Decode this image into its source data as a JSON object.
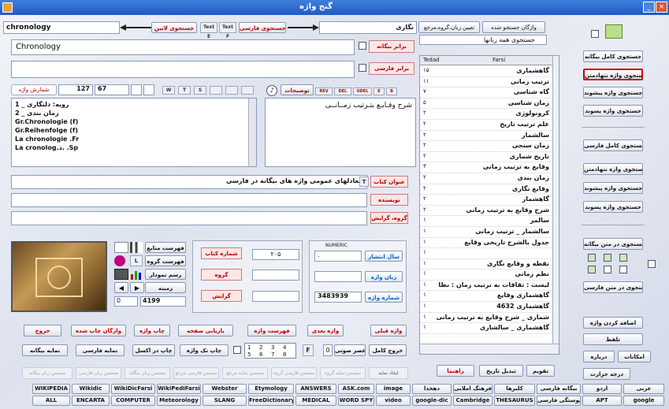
{
  "window": {
    "title": "گنج واژه",
    "min": "_",
    "close": "×"
  },
  "search": {
    "latin_value": "chronology",
    "latin_button": "جستجوی لاتین",
    "text_e": "Text E",
    "text_f": "Text F",
    "persian_button": "جستجوی فارسی",
    "persian_value": "نگاری",
    "mode_buttons": [
      "واژگان جستجو شده",
      "تعیین زبان،گروه،مرجع"
    ],
    "lang_select": "جستجوی همه زبانها",
    "equiv_value": "Chronology",
    "equiv_label": "برابر بیگانه",
    "persian_label": "برابر فارسی"
  },
  "wordlist": {
    "header": [
      "Tedad",
      "Farsi"
    ],
    "rows": [
      {
        "n": "۱۵",
        "w": "گاهشماری"
      },
      {
        "n": "۱۱",
        "w": "ترتیب زمانی"
      },
      {
        "n": "۷",
        "w": "گاه شناسی"
      },
      {
        "n": "۵",
        "w": "زمان شناسی"
      },
      {
        "n": "۲",
        "w": "کرونولوژی"
      },
      {
        "n": "۲",
        "w": "علم ترتیب تاریخ"
      },
      {
        "n": "۲",
        "w": "سالشمار"
      },
      {
        "n": "۲",
        "w": "زمان سنجی"
      },
      {
        "n": "۲",
        "w": "تاریخ شماری"
      },
      {
        "n": "۳",
        "w": "وقایع به ترتیب زمانی"
      },
      {
        "n": "۲",
        "w": "زمان بندی"
      },
      {
        "n": "۲",
        "w": "وقایع نگاری"
      },
      {
        "n": "۲",
        "w": "گاهشمار"
      },
      {
        "n": "۲",
        "w": "شرح وقایع به ترتیب زمانی"
      },
      {
        "n": "۱",
        "w": "سالمر"
      },
      {
        "n": "۱",
        "w": "سالشمار _ ترتیب زمانی"
      },
      {
        "n": "۱",
        "w": "جدول بالشرح تاریخی وقایع"
      },
      {
        "n": "۱",
        "w": ""
      },
      {
        "n": "۱",
        "w": "نقطه و وقایع نگاری"
      },
      {
        "n": "۱",
        "w": "نظم زمانی"
      },
      {
        "n": "۱",
        "w": "لیست : تقاقات به ترتیب زمان : نظا"
      },
      {
        "n": "۱",
        "w": "گاهشماری وقایع"
      },
      {
        "n": "۱",
        "w": "گاهشماری 4632"
      },
      {
        "n": "۱",
        "w": "شماری _ شرح وقایع به ترتیب زمانی"
      },
      {
        "n": "۱",
        "w": "گاهشماری _ سالشاری"
      }
    ]
  },
  "left_buttons": [
    "جستجوی کامل بیگانه",
    "جستجوی واژه نتهادمتن",
    "جستجوی واژه پیشوند",
    "جستجوی واژه پسوند",
    "جستجوی کامل فارسی",
    "جستجوی واژه نتهادمتن",
    "جستجوی واژه پیشوند",
    "جستجوی واژه پسوند",
    "جستجوی در متن بیگانه",
    "جستجوی در متن فارسی",
    "اضافه کردن واژه",
    "تلفظ",
    "درباره",
    "امکانات",
    "درجه حرارت"
  ],
  "stats": {
    "count_label": "شمارش واژه",
    "n1": "127",
    "n2": "67",
    "tag_w": "W",
    "tag_t": "T",
    "tag_s": "S",
    "desc_label": "توضیحات"
  },
  "foreign_list": [
    "رویه: دلنگاری _ 1",
    "زمان بندی _ 2",
    "Gr.Chronologie (f)",
    "Gr.Reihenfolge (f)",
    "La chronologie .Fr",
    "La cronolog.ذ. .Sp"
  ],
  "desc_tags": [
    "REV",
    "DEL",
    "UDEL",
    "E",
    "B"
  ],
  "description": "شرح وقـایـع بتـرتیب زمــانــی",
  "book": {
    "title_label": "عنوان کتاب",
    "t_tag": "T",
    "title_value": "معادلهای عمومی واژه های بیگانه در فارسی",
    "author_label": "نویسنده",
    "group_label": "گروه، گرایش"
  },
  "source_panel": {
    "items": [
      "فهرست منابع",
      "فهرست گروه",
      "رسم نمودار",
      "زمینه"
    ],
    "nav_value": "0",
    "nav_value2": "4199",
    "l_tag": "L"
  },
  "book_fields": {
    "book_no_label": "شماره کتاب",
    "book_no": "۲۰۵",
    "group_label": "گروه",
    "trend_label": "گرایش"
  },
  "numeric": {
    "label": "NUMERIC",
    "year_label": "سال انتشار",
    "year_value": ".",
    "lang_label": "زبان واژه",
    "word_no_label": "شماره واژه",
    "word_no": "3483939"
  },
  "mid_buttons": [
    "تقویم",
    "تبدیل تاریخ",
    "راهنما"
  ],
  "nav_buttons": [
    "واژه قبلی",
    "واژه بعدی",
    "فهرست واژه",
    "بازیابی صفحه",
    "چاپ واژه",
    "واژگان چاپ شده",
    "خروج"
  ],
  "bottom_buttons": [
    "خروج کامل",
    "عصر صوتی",
    "چاپ تک واژه",
    "چاپ در اکسل",
    "نمایه فارسی",
    "نمایه بیگانه"
  ],
  "grid_nums": [
    "1",
    "2",
    "3",
    "4",
    "5",
    "6",
    "7",
    "8"
  ],
  "f_tag": "F",
  "zero": "0",
  "disabled_buttons": [
    "ایجاد نمایه",
    "منضمن نمایه گروه",
    "منضمن فارسی گروه",
    "منضمن نمایه مرجع",
    "منضمن فارسی مرجع",
    "منضمن زبان بیگانه",
    "منضمن زبان فارسی",
    "منضمن زبان بیگانه"
  ],
  "toolbar1": [
    "عربی",
    "اردو",
    "بیگانه فارسی",
    "کلبرها",
    "فرهنگ املایی",
    "دهخدا",
    "image",
    "ASK.com",
    "ANSWERS",
    "Etymology",
    "Webster",
    "WikiPediFarsi",
    "WikiDicFarsi",
    "Wikidic",
    "WIKIPEDIA"
  ],
  "toolbar2": [
    "google",
    "APT",
    "پیوستگی فارسی",
    "THESAURUS",
    "Cambridge",
    "google-dic",
    "video",
    "WORD SPY",
    "MEDICAL",
    "FreeDictionary",
    "SLANG",
    "Meteorology",
    "COMPUTER",
    "ENCARTA",
    "ALL"
  ],
  "colors": {
    "title": "#2258c4",
    "red": "#c00000",
    "accent": "#3f7fdc"
  }
}
